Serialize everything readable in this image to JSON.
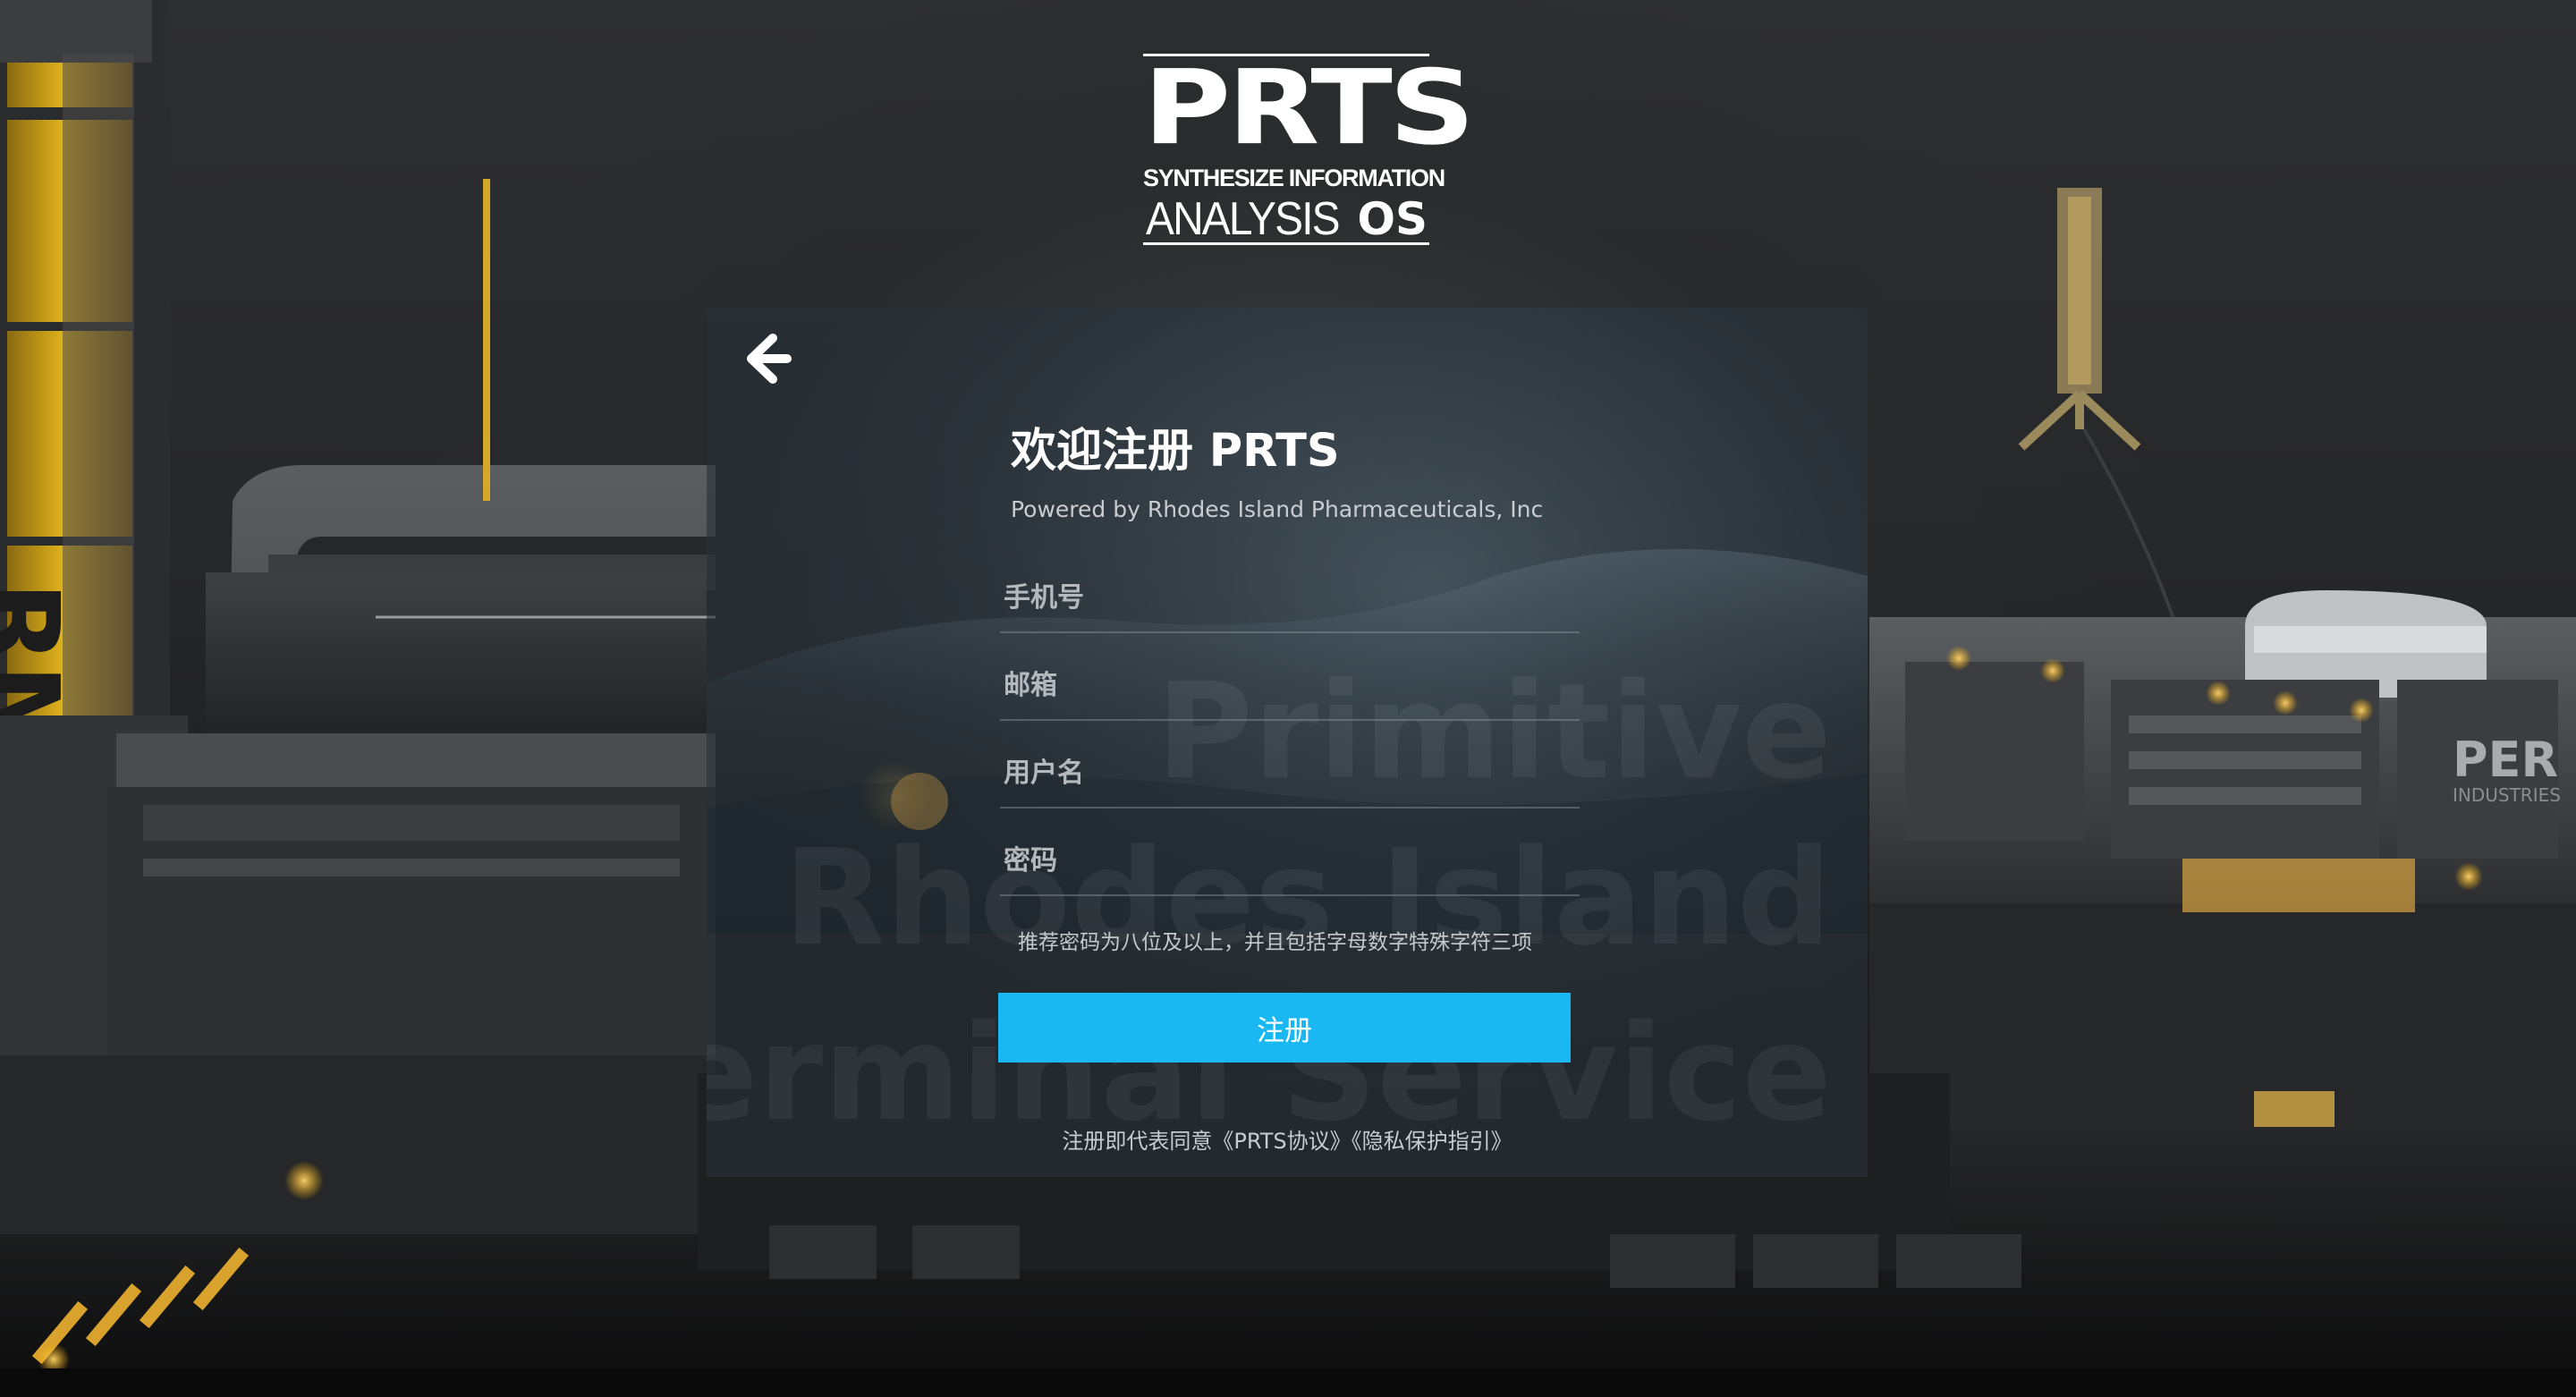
{
  "logo": {
    "main": "PRTS",
    "line1": "SYNTHESIZE INFORMATION",
    "line2": "ANALYSIS",
    "line3": "OS"
  },
  "card": {
    "back_icon": "arrow-left-icon",
    "title": "欢迎注册 PRTS",
    "subtitle": "Powered by Rhodes Island Pharmaceuticals, Inc",
    "watermark": [
      "Primitive",
      "Rhodes Island",
      "Terminal Service"
    ],
    "fields": {
      "phone_placeholder": "手机号",
      "email_placeholder": "邮箱",
      "username_placeholder": "用户名",
      "password_placeholder": "密码"
    },
    "password_hint": "推荐密码为八位及以上，并且包括字母数字特殊字符三项",
    "submit_label": "注册",
    "agreement": {
      "prefix": "注册即代表同意",
      "terms_link": "《PRTS协议》",
      "privacy_link": "《隐私保护指引》"
    }
  },
  "colors": {
    "accent": "#1ab8f3",
    "card_bg": "rgba(38,48,56,0.62)",
    "text_primary": "#ffffff",
    "text_secondary": "#c8ccd0"
  }
}
